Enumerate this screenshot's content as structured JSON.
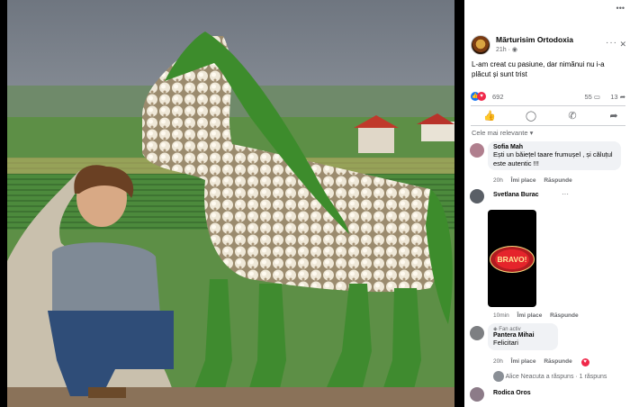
{
  "post": {
    "page_name": "Mărturisim Ortodoxia",
    "meta": "21h · ",
    "text": "L-am creat cu pasiune, dar nimănui nu i-a plăcut și sunt trist",
    "reaction_count": "692",
    "comment_count": "55",
    "share_count": "13"
  },
  "sort_label": "Cele mai relevante",
  "comments": [
    {
      "name": "Sofia Mah",
      "text": "Ești un băiețel taare frumușel , și căluțul este autentic !!!",
      "time": "20h",
      "like": "Îmi place",
      "reply": "Răspunde"
    },
    {
      "name": "Svetlana Burac",
      "gif_text": "BRAVO!",
      "time": "10min",
      "like": "Îmi place",
      "reply": "Răspunde"
    },
    {
      "badge": "Fan activ",
      "name": "Pantera Mihai",
      "text": "Felicitari",
      "time": "20h",
      "like": "Îmi place",
      "reply": "Răspunde"
    },
    {
      "name": "Rodica Oros"
    }
  ],
  "reply_summary": "Alice Neacuta a răspuns · 1 răspuns",
  "colors": {
    "accent": "#1877f2",
    "love": "#f0284a",
    "bubble": "#f0f2f5",
    "meta": "#65676b"
  },
  "icons": [
    "like-icon",
    "comment-icon",
    "whatsapp-icon",
    "share-icon",
    "globe-icon",
    "more-icon",
    "close-icon",
    "heart-icon"
  ]
}
